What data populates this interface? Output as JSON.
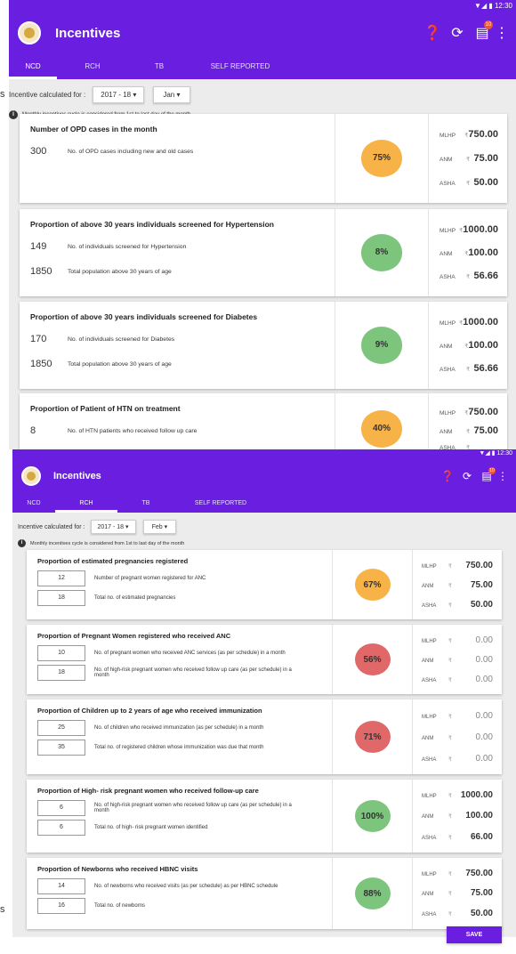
{
  "status_time": "12:30",
  "app_title": "Incentives",
  "badge": "10",
  "tabs": [
    "NCD",
    "RCH",
    "TB",
    "SELF REPORTED"
  ],
  "filter_label": "Incentive  calculated for :",
  "note": "Monthly incentives cycle is considered from 1st to last day of the month",
  "s1": {
    "year": "2017 - 18",
    "month": "Jan",
    "cards": [
      {
        "title": "Number of OPD cases in the month",
        "rows": [
          {
            "v": "300",
            "t": "No. of OPD cases including new and old cases"
          }
        ],
        "pct": "75%",
        "color": "#f7b347",
        "mlhp": "750.00",
        "anm": "75.00",
        "asha": "50.00"
      },
      {
        "title": "Proportion of above 30 years individuals screened for Hypertension",
        "rows": [
          {
            "v": "149",
            "t": "No. of individuals screened for Hypertension"
          },
          {
            "v": "1850",
            "t": "Total population above 30 years of age"
          }
        ],
        "pct": "8%",
        "color": "#7dc47d",
        "mlhp": "1000.00",
        "anm": "100.00",
        "asha": "56.66"
      },
      {
        "title": "Proportion of above 30 years individuals screened for Diabetes",
        "rows": [
          {
            "v": "170",
            "t": "No. of individuals screened for Diabetes"
          },
          {
            "v": "1850",
            "t": "Total population above 30 years of age"
          }
        ],
        "pct": "9%",
        "color": "#7dc47d",
        "mlhp": "1000.00",
        "anm": "100.00",
        "asha": "56.66"
      },
      {
        "title": "Proportion of Patient of HTN on treatment",
        "rows": [
          {
            "v": "8",
            "t": "No. of HTN patients who received follow up care"
          }
        ],
        "pct": "40%",
        "color": "#f7b347",
        "mlhp": "750.00",
        "anm": "75.00",
        "asha": ""
      }
    ]
  },
  "s2": {
    "year": "2017 - 18",
    "month": "Feb",
    "cards": [
      {
        "title": "Proportion of estimated pregnancies registered",
        "rows": [
          {
            "v": "12",
            "t": "Number of pregnant women registered for ANC"
          },
          {
            "v": "18",
            "t": "Total no. of estimated pregnancies"
          }
        ],
        "pct": "67%",
        "color": "#f7b347",
        "mlhp": "750.00",
        "anm": "75.00",
        "asha": "50.00"
      },
      {
        "title": "Proportion of Pregnant Women registered who received ANC",
        "rows": [
          {
            "v": "10",
            "t": "No. of pregnant women who received ANC services (as per schedule) in a month"
          },
          {
            "v": "18",
            "t": "No. of high-risk pregnant women who received follow up care (as per schedule) in a month"
          }
        ],
        "pct": "56%",
        "color": "#e06868",
        "mlhp": "0.00",
        "anm": "0.00",
        "asha": "0.00"
      },
      {
        "title": "Proportion of Children up to 2 years of age who received immunization",
        "rows": [
          {
            "v": "25",
            "t": "No. of children who received immunization (as per schedule) in a month"
          },
          {
            "v": "35",
            "t": "Total no. of registered children whose immunization was due that month"
          }
        ],
        "pct": "71%",
        "color": "#e06868",
        "mlhp": "0.00",
        "anm": "0.00",
        "asha": "0.00"
      },
      {
        "title": "Proportion of High- risk pregnant women who received follow-up care",
        "rows": [
          {
            "v": "6",
            "t": "No. of high-risk pregnant women who received follow up care (as per schedule) in a month"
          },
          {
            "v": "6",
            "t": "Total no. of high- risk pregnant women identified"
          }
        ],
        "pct": "100%",
        "color": "#7dc47d",
        "mlhp": "1000.00",
        "anm": "100.00",
        "asha": "66.00"
      },
      {
        "title": "Proportion of Newborns who received HBNC visits",
        "rows": [
          {
            "v": "14",
            "t": "No. of newborns who received visits (as per schedule) as per HBNC schedule"
          },
          {
            "v": "16",
            "t": "Total no. of newborns"
          }
        ],
        "pct": "88%",
        "color": "#7dc47d",
        "mlhp": "750.00",
        "anm": "75.00",
        "asha": "50.00"
      }
    ]
  },
  "labels": {
    "mlhp": "MLHP",
    "anm": "ANM",
    "asha": "ASHA",
    "rupee": "₹"
  },
  "save": "SAVE",
  "edge_chars": [
    "s",
    "s"
  ]
}
